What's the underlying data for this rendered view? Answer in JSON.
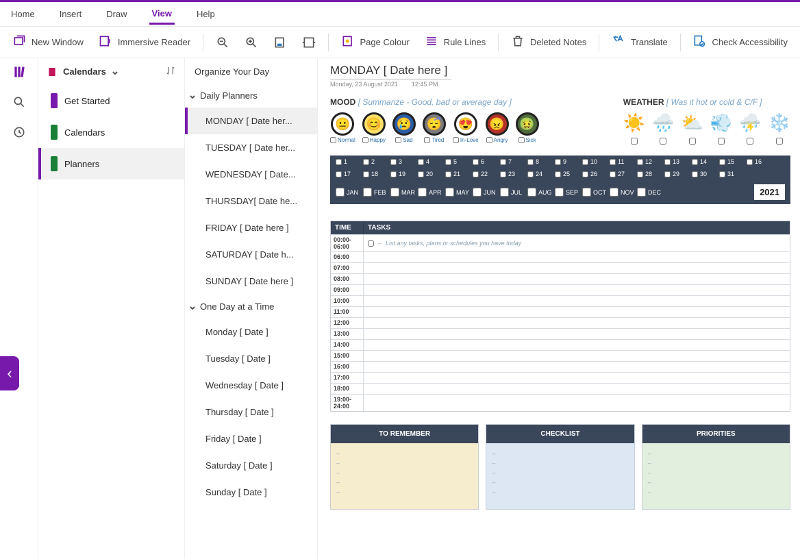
{
  "menu": {
    "items": [
      "Home",
      "Insert",
      "Draw",
      "View",
      "Help"
    ],
    "active": 3
  },
  "ribbon": {
    "new_window": "New Window",
    "immersive": "Immersive Reader",
    "page_colour": "Page Colour",
    "rule_lines": "Rule Lines",
    "deleted_notes": "Deleted Notes",
    "translate": "Translate",
    "accessibility": "Check Accessibility"
  },
  "notebook": {
    "name": "Calendars",
    "sections": [
      {
        "label": "Get Started",
        "color": "#7719aa"
      },
      {
        "label": "Calendars",
        "color": "#1a7f37"
      },
      {
        "label": "Planners",
        "color": "#1a7f37",
        "selected": true
      }
    ]
  },
  "pages": {
    "header": "Organize Your Day",
    "groups": [
      {
        "label": "Daily Planners",
        "expanded": true,
        "pages": [
          {
            "label": "MONDAY [ Date her...",
            "selected": true
          },
          {
            "label": "TUESDAY [ Date her..."
          },
          {
            "label": "WEDNESDAY [ Date..."
          },
          {
            "label": "THURSDAY[ Date he..."
          },
          {
            "label": "FRIDAY [ Date here ]"
          },
          {
            "label": "SATURDAY [ Date h..."
          },
          {
            "label": "SUNDAY [ Date here ]"
          }
        ]
      },
      {
        "label": "One Day at a Time",
        "expanded": true,
        "pages": [
          {
            "label": "Monday [ Date ]"
          },
          {
            "label": "Tuesday [ Date ]"
          },
          {
            "label": "Wednesday [ Date ]"
          },
          {
            "label": "Thursday [ Date ]"
          },
          {
            "label": "Friday [ Date ]"
          },
          {
            "label": "Saturday [ Date ]"
          },
          {
            "label": "Sunday [ Date ]"
          }
        ]
      }
    ]
  },
  "page": {
    "title": "MONDAY [ Date here ]",
    "date": "Monday, 23 August 2021",
    "time": "12:45 PM",
    "mood": {
      "label": "MOOD",
      "hint": "[ Summarize - Good, bad or average day ]",
      "items": [
        {
          "name": "Normal",
          "bg": "#ffffff",
          "face": "😐"
        },
        {
          "name": "Happy",
          "bg": "#ffe169",
          "face": "😊"
        },
        {
          "name": "Sad",
          "bg": "#2b5ea8",
          "face": "😢"
        },
        {
          "name": "Tired",
          "bg": "#7c7c7c",
          "face": "😴"
        },
        {
          "name": "In-Love",
          "bg": "#ffffff",
          "face": "😍"
        },
        {
          "name": "Angry",
          "bg": "#b53127",
          "face": "😠"
        },
        {
          "name": "Sick",
          "bg": "#4f6b3a",
          "face": "🤢"
        }
      ]
    },
    "weather": {
      "label": "WEATHER",
      "hint": "[ Was it hot or cold & C/F ]",
      "items": [
        "☀️",
        "🌧️",
        "⛅",
        "💨",
        "⛈️",
        "❄️"
      ]
    },
    "days_row1": [
      "1",
      "2",
      "3",
      "4",
      "5",
      "6",
      "7",
      "8",
      "9",
      "10",
      "11",
      "12",
      "13",
      "14",
      "15",
      "16"
    ],
    "days_row2": [
      "17",
      "18",
      "19",
      "20",
      "21",
      "22",
      "23",
      "24",
      "25",
      "26",
      "27",
      "28",
      "29",
      "30",
      "31"
    ],
    "months": [
      "JAN",
      "FEB",
      "MAR",
      "APR",
      "MAY",
      "JUN",
      "JUL",
      "AUG",
      "SEP",
      "OCT",
      "NOV",
      "DEC"
    ],
    "year": "2021",
    "tasks": {
      "head_time": "TIME",
      "head_tasks": "TASKS",
      "example_hint": "List any tasks, plans or schedules you have today",
      "slots": [
        "00:00-06:00",
        "06:00",
        "07:00",
        "08:00",
        "09:00",
        "10:00",
        "11:00",
        "12:00",
        "13:00",
        "14:00",
        "15:00",
        "16:00",
        "17:00",
        "18:00",
        "19:00-24:00"
      ]
    },
    "boxes": {
      "remember": "TO REMEMBER",
      "checklist": "CHECKLIST",
      "priorities": "PRIORITIES"
    }
  }
}
